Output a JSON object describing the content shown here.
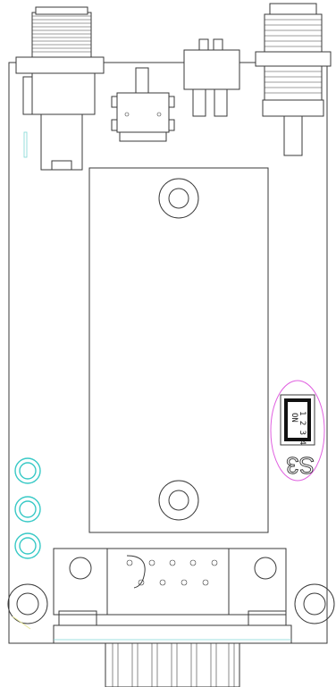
{
  "diagram": {
    "switch_label": "ON",
    "switch_positions": "1 2 3 4",
    "component_label": "S3",
    "colors": {
      "outline": "#3a3a3a",
      "led": "#38c9c6",
      "highlight": "#e060e0"
    }
  }
}
